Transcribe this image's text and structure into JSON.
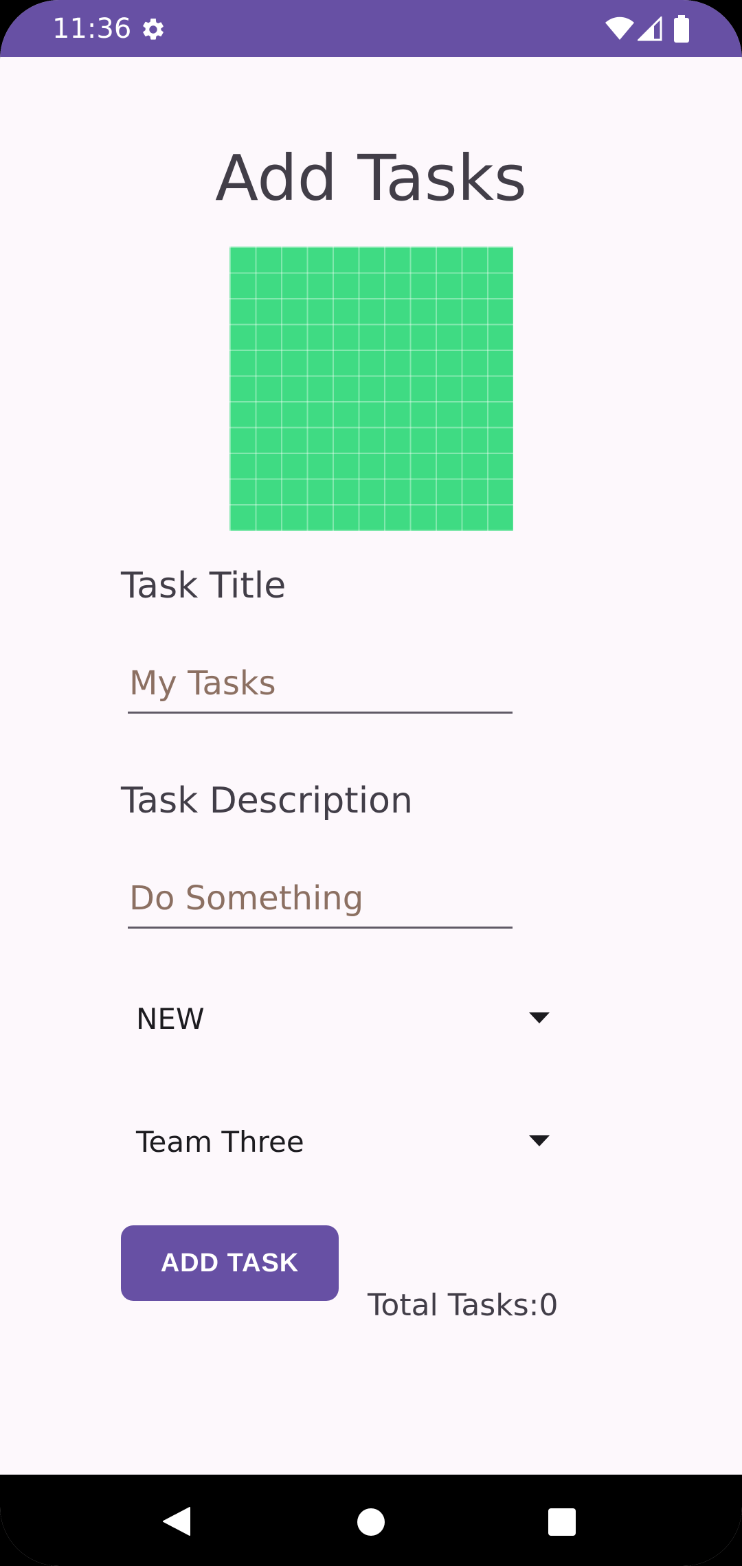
{
  "status_bar": {
    "time": "11:36",
    "icons": [
      "gear-icon",
      "wifi-icon",
      "signal-icon",
      "battery-icon"
    ],
    "color": "#6750a4"
  },
  "page": {
    "title": "Add Tasks",
    "image": "green-grid-image",
    "image_color": "#3fdb83"
  },
  "form": {
    "title_label": "Task Title",
    "title_value": "My Tasks",
    "description_label": "Task Description",
    "description_value": "Do Something",
    "status_spinner": {
      "selected": "NEW"
    },
    "team_spinner": {
      "selected": "Team Three"
    },
    "add_button_label": "ADD TASK",
    "total_tasks": "Total Tasks:0"
  },
  "nav_bar": {
    "icons": [
      "back-icon",
      "home-icon",
      "recents-icon"
    ]
  },
  "colors": {
    "accent": "#6750a4",
    "background": "#fdf8fc",
    "field_text": "#8c7062"
  }
}
